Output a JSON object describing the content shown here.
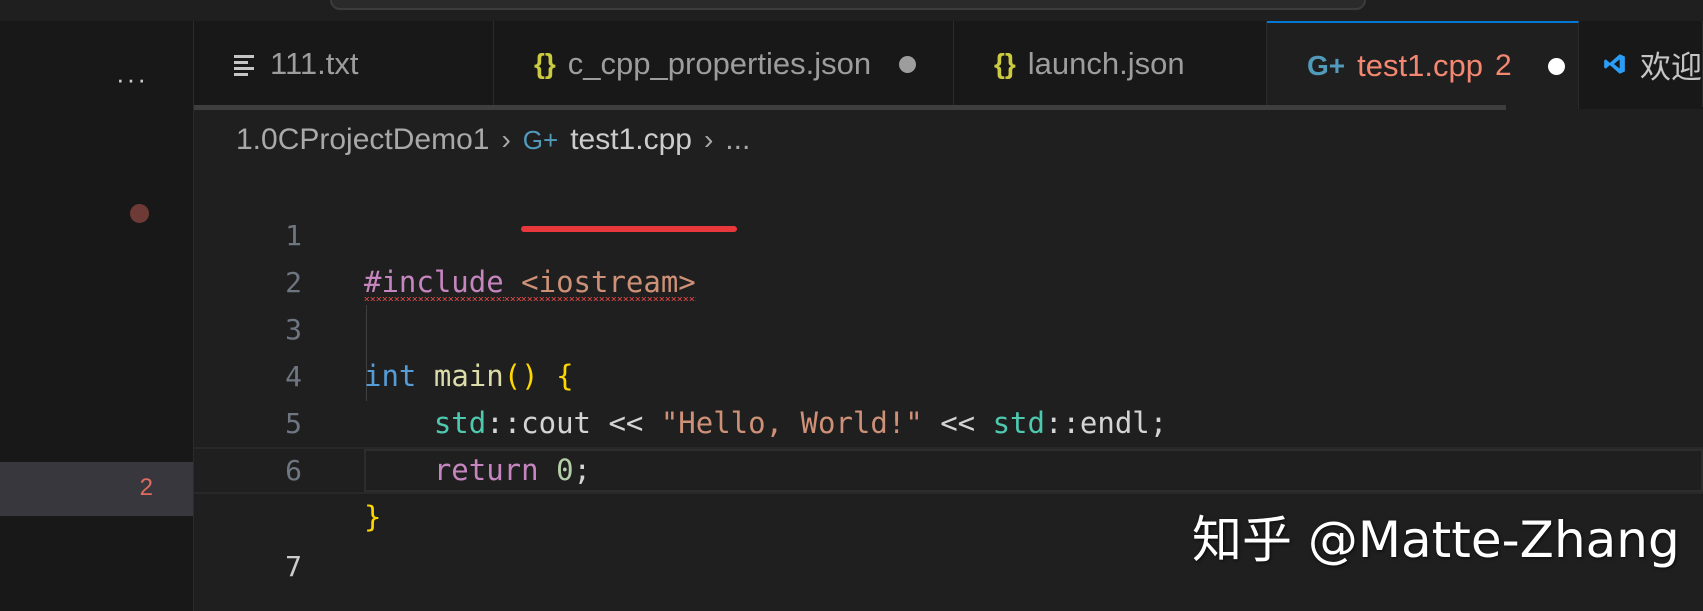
{
  "tabs": {
    "more_label": "···",
    "items": [
      {
        "label": "111.txt",
        "icon": "text-file-icon"
      },
      {
        "label": "c_cpp_properties.json",
        "icon": "json-braces-icon",
        "icon_glyph": "{}",
        "modified": true
      },
      {
        "label": "launch.json",
        "icon": "json-braces-icon",
        "icon_glyph": "{}"
      },
      {
        "label": "test1.cpp",
        "icon": "cpp-file-icon",
        "icon_glyph": "G+",
        "problems": "2",
        "modified": true,
        "active": true
      },
      {
        "label": "欢迎",
        "icon": "vscode-logo-icon"
      }
    ]
  },
  "breadcrumb": {
    "folder": "1.0CProjectDemo1",
    "separator": "›",
    "file": "test1.cpp",
    "ellipsis": "..."
  },
  "sidebar": {
    "problem_count": "2"
  },
  "editor": {
    "line_numbers": [
      "1",
      "2",
      "3",
      "4",
      "5",
      "6",
      "7"
    ],
    "current_line": 7,
    "lines": {
      "l1_directive": "#include",
      "l1_header": "<iostream>",
      "l3_type": "int",
      "l3_fn": "main",
      "l3_parens": "()",
      "l3_brace": "{",
      "l4_ns1": "std",
      "l4_op1": "::cout << ",
      "l4_str": "\"Hello, World!\"",
      "l4_op2": " << ",
      "l4_ns2": "std",
      "l4_tail": "::endl;",
      "l5_kw": "return",
      "l5_num": "0",
      "l5_semi": ";",
      "l6_brace": "}"
    }
  },
  "watermark": "知乎 @Matte-Zhang",
  "colors": {
    "accent": "#0078d4",
    "error": "#f14c4c",
    "background": "#1f1f1f"
  }
}
